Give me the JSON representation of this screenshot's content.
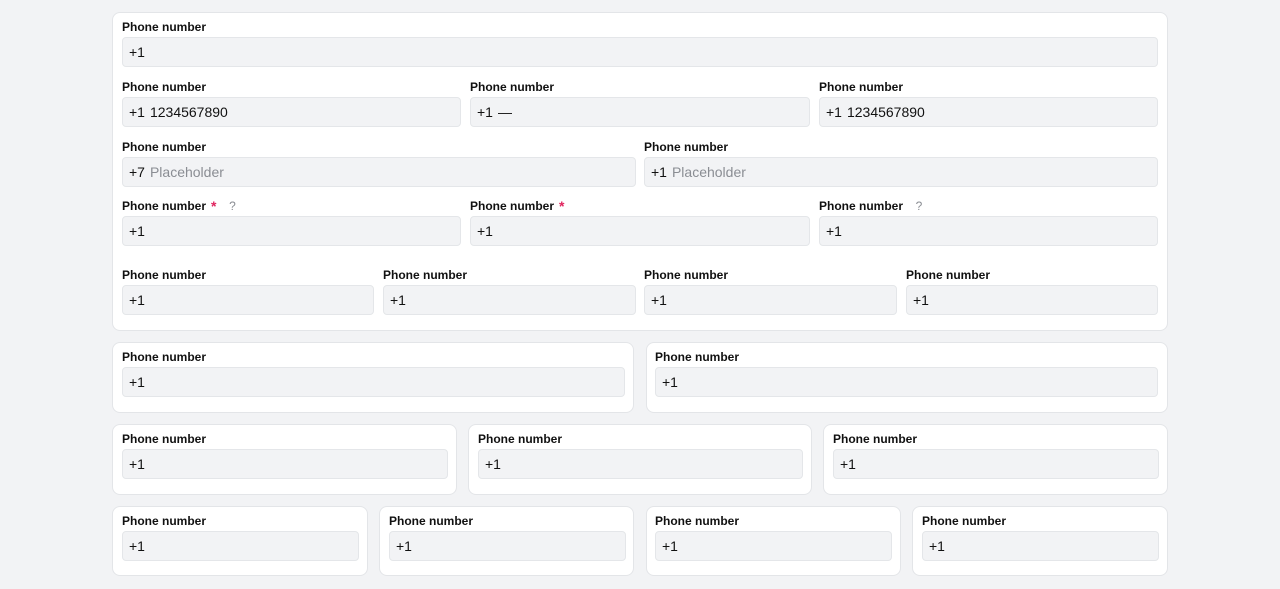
{
  "label": "Phone number",
  "required_mark": "*",
  "help_mark": "?",
  "f01": {
    "code": "+1",
    "value": ""
  },
  "f02": {
    "code": "+1",
    "value": "1234567890"
  },
  "f03": {
    "code": "+1",
    "value": "—"
  },
  "f04": {
    "code": "+1",
    "value": "1234567890"
  },
  "f05": {
    "code": "+7",
    "value": "",
    "placeholder": "Placeholder"
  },
  "f06": {
    "code": "+1",
    "value": "",
    "placeholder": "Placeholder"
  },
  "f07": {
    "code": "+1",
    "value": ""
  },
  "f08": {
    "code": "+1",
    "value": ""
  },
  "f09": {
    "code": "+1",
    "value": ""
  },
  "f10": {
    "code": "+1",
    "value": ""
  },
  "f11": {
    "code": "+1",
    "value": ""
  },
  "f12": {
    "code": "+1",
    "value": ""
  },
  "f13": {
    "code": "+1",
    "value": ""
  },
  "f14": {
    "code": "+1",
    "value": ""
  },
  "f15": {
    "code": "+1",
    "value": ""
  },
  "f16": {
    "code": "+1",
    "value": ""
  },
  "f17": {
    "code": "+1",
    "value": ""
  },
  "f18": {
    "code": "+1",
    "value": ""
  },
  "f19": {
    "code": "+1",
    "value": ""
  },
  "f20": {
    "code": "+1",
    "value": ""
  },
  "f21": {
    "code": "+1",
    "value": ""
  },
  "f22": {
    "code": "+1",
    "value": ""
  }
}
